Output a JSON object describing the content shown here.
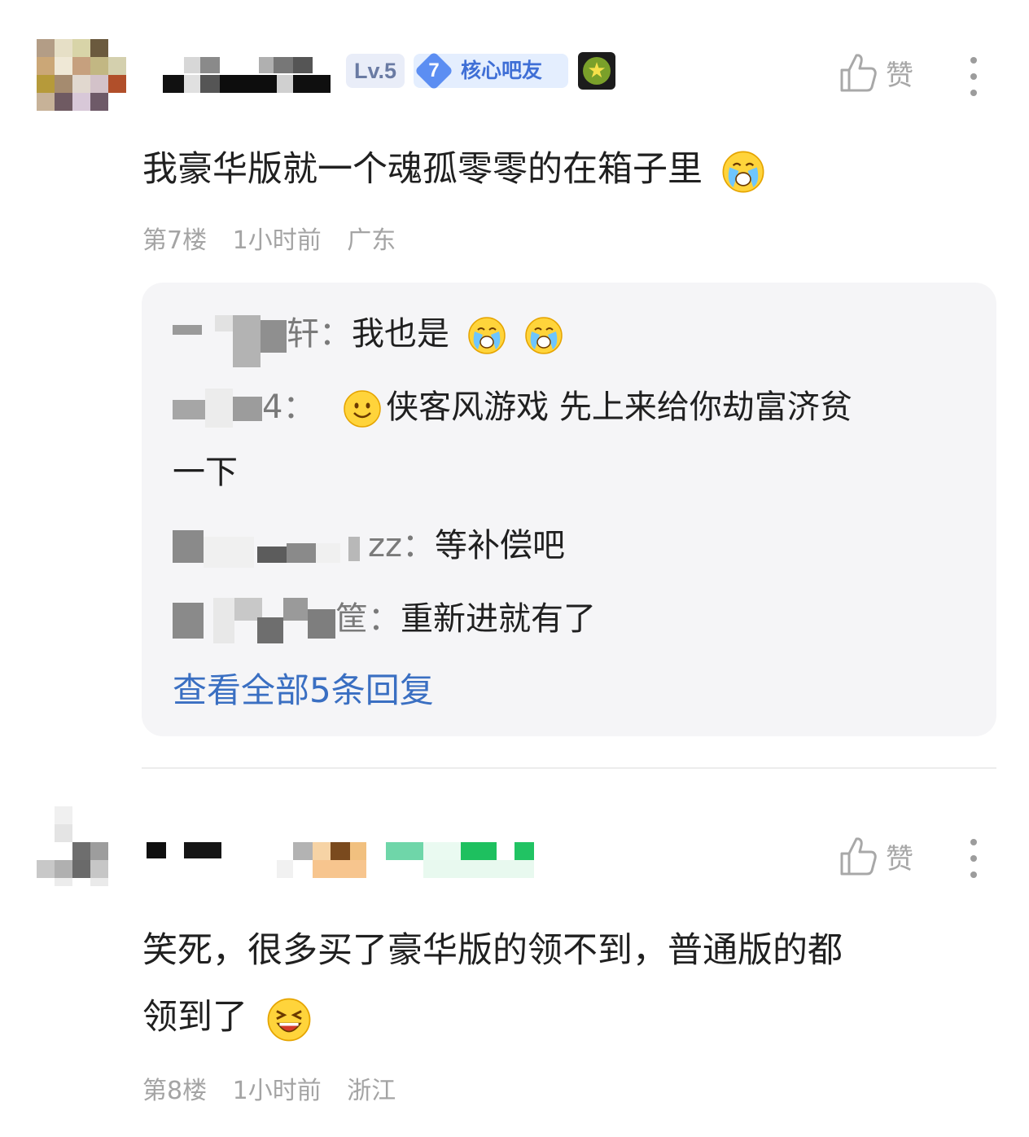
{
  "comments": [
    {
      "badges": {
        "level": "Lv.5",
        "core_number": "7",
        "core_label": "核心吧友"
      },
      "like_label": "赞",
      "text": "我豪华版就一个魂孤零零的在箱子里",
      "meta": {
        "floor": "第7楼",
        "time": "1小时前",
        "location": "广东"
      },
      "replies": [
        {
          "name_suffix": "轩：",
          "text": "我也是"
        },
        {
          "name_suffix": "4：",
          "text": "侠客风游戏 先上来给你劫富济贫",
          "text_cont": "一下"
        },
        {
          "name_suffix": "zz：",
          "text": "等补偿吧"
        },
        {
          "name_suffix": "筐：",
          "text": "重新进就有了"
        }
      ],
      "view_all": "查看全部5条回复"
    },
    {
      "like_label": "赞",
      "text_line1": "笑死，很多买了豪华版的领不到，普通版的都",
      "text_line2": "领到了",
      "meta": {
        "floor": "第8楼",
        "time": "1小时前",
        "location": "浙江"
      }
    }
  ],
  "colors": {
    "link": "#3a6fc2",
    "meta": "#a4a4a4",
    "reply_bg": "#f5f5f7",
    "level_badge_bg": "#e9edf8",
    "core_badge_bg": "#e4eefe"
  },
  "icons": [
    "thumbs-up-icon",
    "more-vertical-icon",
    "crying-emoji-icon",
    "smile-emoji-icon",
    "laughing-emoji-icon",
    "medal-icon"
  ]
}
